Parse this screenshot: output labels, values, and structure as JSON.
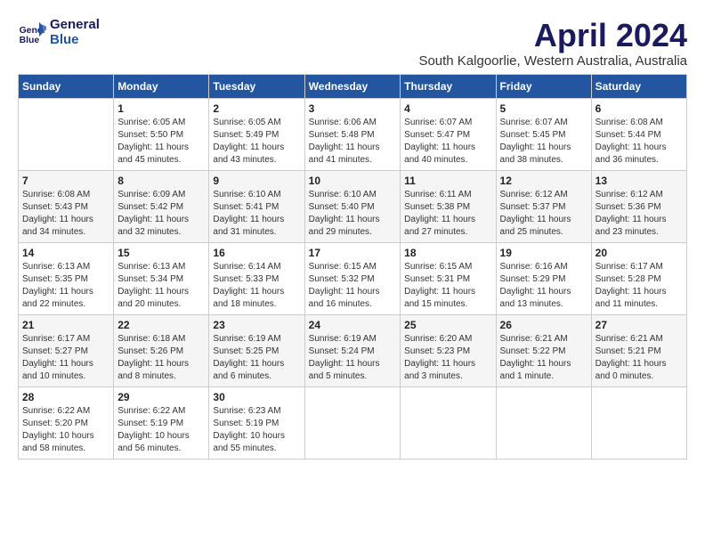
{
  "logo": {
    "line1": "General",
    "line2": "Blue"
  },
  "title": "April 2024",
  "subtitle": "South Kalgoorlie, Western Australia, Australia",
  "days_of_week": [
    "Sunday",
    "Monday",
    "Tuesday",
    "Wednesday",
    "Thursday",
    "Friday",
    "Saturday"
  ],
  "weeks": [
    [
      {
        "day": "",
        "sunrise": "",
        "sunset": "",
        "daylight": ""
      },
      {
        "day": "1",
        "sunrise": "Sunrise: 6:05 AM",
        "sunset": "Sunset: 5:50 PM",
        "daylight": "Daylight: 11 hours and 45 minutes."
      },
      {
        "day": "2",
        "sunrise": "Sunrise: 6:05 AM",
        "sunset": "Sunset: 5:49 PM",
        "daylight": "Daylight: 11 hours and 43 minutes."
      },
      {
        "day": "3",
        "sunrise": "Sunrise: 6:06 AM",
        "sunset": "Sunset: 5:48 PM",
        "daylight": "Daylight: 11 hours and 41 minutes."
      },
      {
        "day": "4",
        "sunrise": "Sunrise: 6:07 AM",
        "sunset": "Sunset: 5:47 PM",
        "daylight": "Daylight: 11 hours and 40 minutes."
      },
      {
        "day": "5",
        "sunrise": "Sunrise: 6:07 AM",
        "sunset": "Sunset: 5:45 PM",
        "daylight": "Daylight: 11 hours and 38 minutes."
      },
      {
        "day": "6",
        "sunrise": "Sunrise: 6:08 AM",
        "sunset": "Sunset: 5:44 PM",
        "daylight": "Daylight: 11 hours and 36 minutes."
      }
    ],
    [
      {
        "day": "7",
        "sunrise": "Sunrise: 6:08 AM",
        "sunset": "Sunset: 5:43 PM",
        "daylight": "Daylight: 11 hours and 34 minutes."
      },
      {
        "day": "8",
        "sunrise": "Sunrise: 6:09 AM",
        "sunset": "Sunset: 5:42 PM",
        "daylight": "Daylight: 11 hours and 32 minutes."
      },
      {
        "day": "9",
        "sunrise": "Sunrise: 6:10 AM",
        "sunset": "Sunset: 5:41 PM",
        "daylight": "Daylight: 11 hours and 31 minutes."
      },
      {
        "day": "10",
        "sunrise": "Sunrise: 6:10 AM",
        "sunset": "Sunset: 5:40 PM",
        "daylight": "Daylight: 11 hours and 29 minutes."
      },
      {
        "day": "11",
        "sunrise": "Sunrise: 6:11 AM",
        "sunset": "Sunset: 5:38 PM",
        "daylight": "Daylight: 11 hours and 27 minutes."
      },
      {
        "day": "12",
        "sunrise": "Sunrise: 6:12 AM",
        "sunset": "Sunset: 5:37 PM",
        "daylight": "Daylight: 11 hours and 25 minutes."
      },
      {
        "day": "13",
        "sunrise": "Sunrise: 6:12 AM",
        "sunset": "Sunset: 5:36 PM",
        "daylight": "Daylight: 11 hours and 23 minutes."
      }
    ],
    [
      {
        "day": "14",
        "sunrise": "Sunrise: 6:13 AM",
        "sunset": "Sunset: 5:35 PM",
        "daylight": "Daylight: 11 hours and 22 minutes."
      },
      {
        "day": "15",
        "sunrise": "Sunrise: 6:13 AM",
        "sunset": "Sunset: 5:34 PM",
        "daylight": "Daylight: 11 hours and 20 minutes."
      },
      {
        "day": "16",
        "sunrise": "Sunrise: 6:14 AM",
        "sunset": "Sunset: 5:33 PM",
        "daylight": "Daylight: 11 hours and 18 minutes."
      },
      {
        "day": "17",
        "sunrise": "Sunrise: 6:15 AM",
        "sunset": "Sunset: 5:32 PM",
        "daylight": "Daylight: 11 hours and 16 minutes."
      },
      {
        "day": "18",
        "sunrise": "Sunrise: 6:15 AM",
        "sunset": "Sunset: 5:31 PM",
        "daylight": "Daylight: 11 hours and 15 minutes."
      },
      {
        "day": "19",
        "sunrise": "Sunrise: 6:16 AM",
        "sunset": "Sunset: 5:29 PM",
        "daylight": "Daylight: 11 hours and 13 minutes."
      },
      {
        "day": "20",
        "sunrise": "Sunrise: 6:17 AM",
        "sunset": "Sunset: 5:28 PM",
        "daylight": "Daylight: 11 hours and 11 minutes."
      }
    ],
    [
      {
        "day": "21",
        "sunrise": "Sunrise: 6:17 AM",
        "sunset": "Sunset: 5:27 PM",
        "daylight": "Daylight: 11 hours and 10 minutes."
      },
      {
        "day": "22",
        "sunrise": "Sunrise: 6:18 AM",
        "sunset": "Sunset: 5:26 PM",
        "daylight": "Daylight: 11 hours and 8 minutes."
      },
      {
        "day": "23",
        "sunrise": "Sunrise: 6:19 AM",
        "sunset": "Sunset: 5:25 PM",
        "daylight": "Daylight: 11 hours and 6 minutes."
      },
      {
        "day": "24",
        "sunrise": "Sunrise: 6:19 AM",
        "sunset": "Sunset: 5:24 PM",
        "daylight": "Daylight: 11 hours and 5 minutes."
      },
      {
        "day": "25",
        "sunrise": "Sunrise: 6:20 AM",
        "sunset": "Sunset: 5:23 PM",
        "daylight": "Daylight: 11 hours and 3 minutes."
      },
      {
        "day": "26",
        "sunrise": "Sunrise: 6:21 AM",
        "sunset": "Sunset: 5:22 PM",
        "daylight": "Daylight: 11 hours and 1 minute."
      },
      {
        "day": "27",
        "sunrise": "Sunrise: 6:21 AM",
        "sunset": "Sunset: 5:21 PM",
        "daylight": "Daylight: 11 hours and 0 minutes."
      }
    ],
    [
      {
        "day": "28",
        "sunrise": "Sunrise: 6:22 AM",
        "sunset": "Sunset: 5:20 PM",
        "daylight": "Daylight: 10 hours and 58 minutes."
      },
      {
        "day": "29",
        "sunrise": "Sunrise: 6:22 AM",
        "sunset": "Sunset: 5:19 PM",
        "daylight": "Daylight: 10 hours and 56 minutes."
      },
      {
        "day": "30",
        "sunrise": "Sunrise: 6:23 AM",
        "sunset": "Sunset: 5:19 PM",
        "daylight": "Daylight: 10 hours and 55 minutes."
      },
      {
        "day": "",
        "sunrise": "",
        "sunset": "",
        "daylight": ""
      },
      {
        "day": "",
        "sunrise": "",
        "sunset": "",
        "daylight": ""
      },
      {
        "day": "",
        "sunrise": "",
        "sunset": "",
        "daylight": ""
      },
      {
        "day": "",
        "sunrise": "",
        "sunset": "",
        "daylight": ""
      }
    ]
  ]
}
